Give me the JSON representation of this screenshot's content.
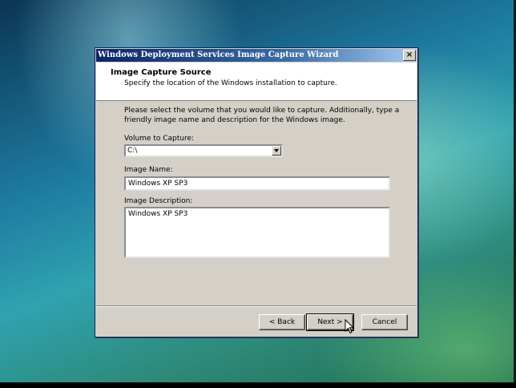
{
  "window": {
    "title": "Windows Deployment Services Image Capture Wizard",
    "close_glyph": "×"
  },
  "header": {
    "title": "Image Capture Source",
    "subtitle": "Specify the location of the Windows installation to capture."
  },
  "instructions": "Please select the volume that you would like to capture. Additionally, type a friendly image name and description for the Windows image.",
  "volume": {
    "label": "Volume to Capture:",
    "value": "C:\\"
  },
  "image_name": {
    "label": "Image Name:",
    "value": "Windows XP SP3"
  },
  "image_description": {
    "label": "Image Description:",
    "value": "Windows XP SP3"
  },
  "buttons": {
    "back": "< Back",
    "next": "Next >",
    "cancel": "Cancel"
  },
  "icons": {
    "close": "close-icon",
    "dropdown": "chevron-down-icon",
    "cursor": "mouse-pointer-icon"
  }
}
